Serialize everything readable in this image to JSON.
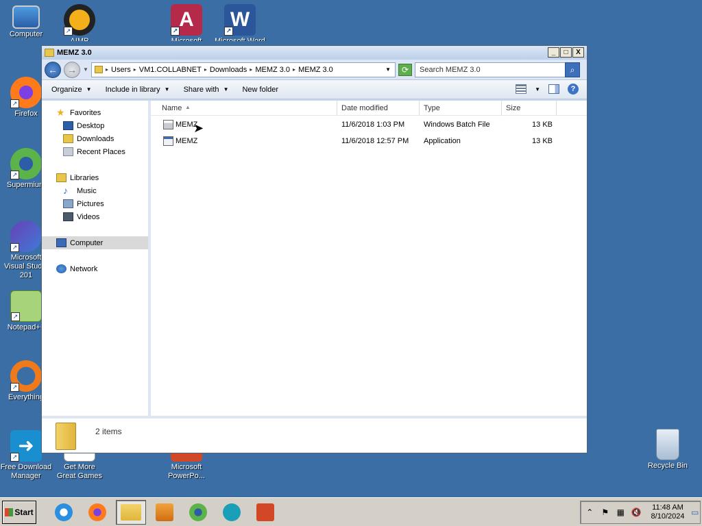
{
  "desktop": {
    "icons": [
      {
        "label": "Computer",
        "icon": "computer-icon"
      },
      {
        "label": "AIMP",
        "icon": "aimp-icon"
      },
      {
        "label": "Microsoft",
        "icon": "access-icon"
      },
      {
        "label": "Microsoft Word",
        "icon": "word-icon"
      },
      {
        "label": "Firefox",
        "icon": "firefox-icon"
      },
      {
        "label": "Supermium",
        "icon": "supermium-icon"
      },
      {
        "label": "Microsoft Visual Studio 201",
        "icon": "visual-studio-icon"
      },
      {
        "label": "Notepad++",
        "icon": "notepadpp-icon"
      },
      {
        "label": "Everything",
        "icon": "everything-icon"
      },
      {
        "label": "Free Download Manager",
        "icon": "fdm-icon"
      },
      {
        "label": "Get More Great Games",
        "icon": "games-icon"
      },
      {
        "label": "Microsoft PowerPo...",
        "icon": "powerpoint-icon"
      },
      {
        "label": "Recycle Bin",
        "icon": "recycle-bin-icon"
      }
    ]
  },
  "window": {
    "title": "MEMZ 3.0",
    "controls": {
      "minimize": "_",
      "maximize": "□",
      "close": "X"
    },
    "breadcrumb": [
      "Users",
      "VM1.COLLABNET",
      "Downloads",
      "MEMZ 3.0",
      "MEMZ 3.0"
    ],
    "search_placeholder": "Search MEMZ 3.0",
    "commands": {
      "organize": "Organize",
      "include_in_library": "Include in library",
      "share_with": "Share with",
      "new_folder": "New folder"
    },
    "nav": {
      "favorites": "Favorites",
      "desktop": "Desktop",
      "downloads": "Downloads",
      "recent_places": "Recent Places",
      "libraries": "Libraries",
      "music": "Music",
      "pictures": "Pictures",
      "videos": "Videos",
      "computer": "Computer",
      "network": "Network"
    },
    "columns": {
      "name": "Name",
      "date": "Date modified",
      "type": "Type",
      "size": "Size"
    },
    "files": [
      {
        "name": "MEMZ",
        "date": "11/6/2018 1:03 PM",
        "type": "Windows Batch File",
        "size": "13 KB"
      },
      {
        "name": "MEMZ",
        "date": "11/6/2018 12:57 PM",
        "type": "Application",
        "size": "13 KB"
      }
    ],
    "status": "2 items"
  },
  "taskbar": {
    "start_label": "Start",
    "apps": [
      "internet-explorer-icon",
      "firefox-icon",
      "explorer-icon",
      "media-player-icon",
      "supermium-icon",
      "accessibility-icon",
      "powerpoint-icon"
    ],
    "clock_time": "11:48 AM",
    "clock_date": "8/10/2024"
  },
  "colors": {
    "desktop": "#3a6ea5",
    "taskbar": "#d4d0c8",
    "window_frame": "#c8d7ea"
  }
}
